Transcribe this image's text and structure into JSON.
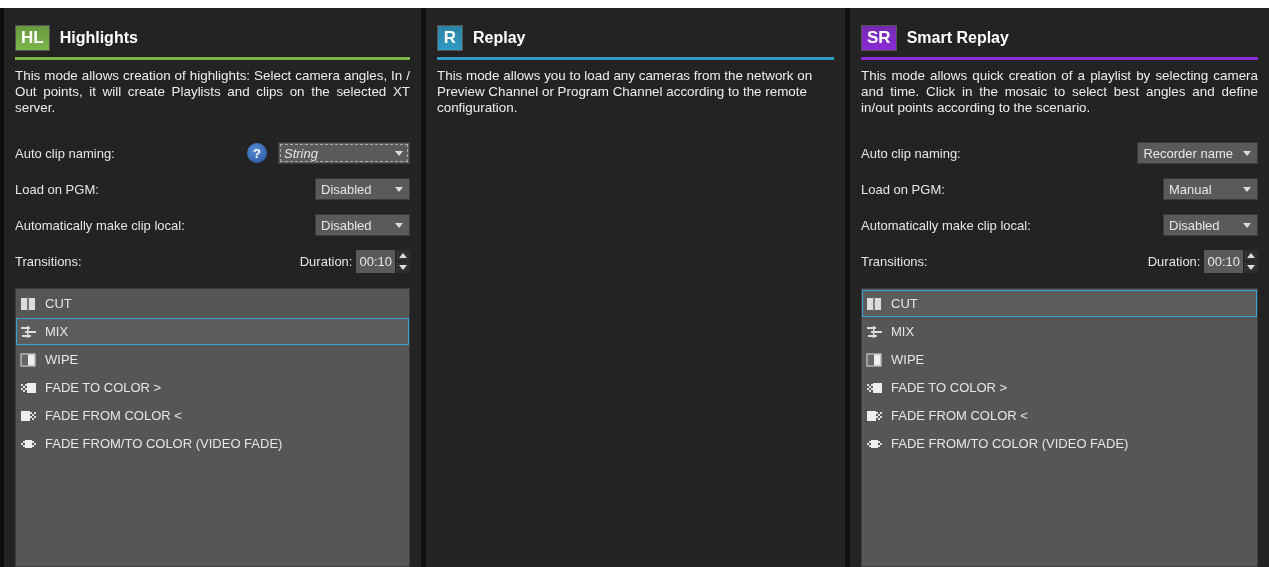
{
  "panels": [
    {
      "badge": "HL",
      "title": "Highlights",
      "color": "#7ab648",
      "description": "This mode allows creation of highlights: Select camera angles, In / Out points, it will create Playlists and clips on the selected XT server.",
      "justify": true,
      "settings": [
        {
          "label": "Auto clip naming:",
          "help": "?",
          "value": "String",
          "focused": true
        },
        {
          "label": "Load on PGM:",
          "value": "Disabled",
          "focused": false
        },
        {
          "label": "Automatically make clip local:",
          "value": "Disabled",
          "focused": false
        }
      ],
      "transitions_label": "Transitions:",
      "duration_label": "Duration:",
      "duration": "00:10",
      "transitions": [
        {
          "kind": "cut",
          "label": "CUT",
          "selected": false
        },
        {
          "kind": "mix",
          "label": "MIX",
          "selected": true
        },
        {
          "kind": "wipe",
          "label": "WIPE",
          "selected": false
        },
        {
          "kind": "fade-to",
          "label": "FADE TO COLOR >",
          "selected": false
        },
        {
          "kind": "fade-from",
          "label": "FADE FROM COLOR <",
          "selected": false
        },
        {
          "kind": "fade-both",
          "label": "FADE FROM/TO COLOR (VIDEO FADE)",
          "selected": false
        }
      ]
    },
    {
      "badge": "R",
      "title": "Replay",
      "color": "#2f9bc4",
      "description": "This mode allows you to load any cameras from the network on Preview Channel or Program Channel according to the remote configuration.",
      "justify": false
    },
    {
      "badge": "SR",
      "title": "Smart Replay",
      "color": "#8a2bd6",
      "description": "This mode allows quick creation of a playlist by selecting camera and time. Click in the mosaic to select best angles and define in/out points according to the scenario.",
      "justify": true,
      "settings": [
        {
          "label": "Auto clip naming:",
          "value": "Recorder name",
          "focused": false
        },
        {
          "label": "Load on PGM:",
          "value": "Manual",
          "focused": false
        },
        {
          "label": "Automatically make clip local:",
          "value": "Disabled",
          "focused": false
        }
      ],
      "transitions_label": "Transitions:",
      "duration_label": "Duration:",
      "duration": "00:10",
      "transitions": [
        {
          "kind": "cut",
          "label": "CUT",
          "selected": true
        },
        {
          "kind": "mix",
          "label": "MIX",
          "selected": false
        },
        {
          "kind": "wipe",
          "label": "WIPE",
          "selected": false
        },
        {
          "kind": "fade-to",
          "label": "FADE TO COLOR >",
          "selected": false
        },
        {
          "kind": "fade-from",
          "label": "FADE FROM COLOR <",
          "selected": false
        },
        {
          "kind": "fade-both",
          "label": "FADE FROM/TO COLOR (VIDEO FADE)",
          "selected": false
        }
      ]
    }
  ]
}
